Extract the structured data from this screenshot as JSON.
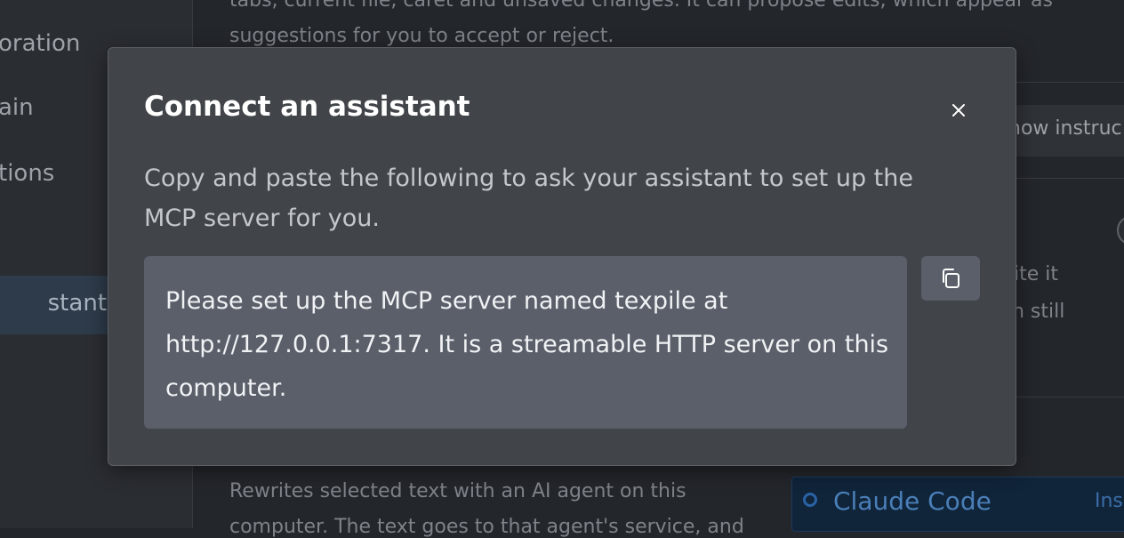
{
  "background": {
    "sidebar": {
      "items": [
        {
          "label": "oration"
        },
        {
          "label": "ain"
        },
        {
          "label": "tions"
        },
        {
          "label": "stant"
        }
      ]
    },
    "content": {
      "top_line_1": "tabs, current file, caret and unsaved changes. It can propose edits, which appear as",
      "top_line_2": "suggestions for you to accept or reject.",
      "show_instructions_label": "how instruc",
      "fragment_1": "ite it",
      "fragment_2": "n still",
      "bottom_line_1": "Rewrites selected text with an AI agent on this",
      "bottom_line_2": "computer. The text goes to that agent's service, and"
    },
    "agent_option": {
      "name": "Claude Code",
      "action": "Ins"
    }
  },
  "modal": {
    "title": "Connect an assistant",
    "close_icon": "close-icon",
    "description": "Copy and paste the following to ask your assistant to set up the MCP server for you.",
    "prompt_lines": [
      "Please set up the MCP server named texpile at",
      "http://127.0.0.1:7317. It is a streamable HTTP server on this",
      "computer."
    ],
    "copy_icon": "copy-icon"
  },
  "colors": {
    "modal_bg": "#414549",
    "prompt_bg": "#5a5f6a",
    "page_bg": "#23262b",
    "accent": "#2a62a6"
  }
}
